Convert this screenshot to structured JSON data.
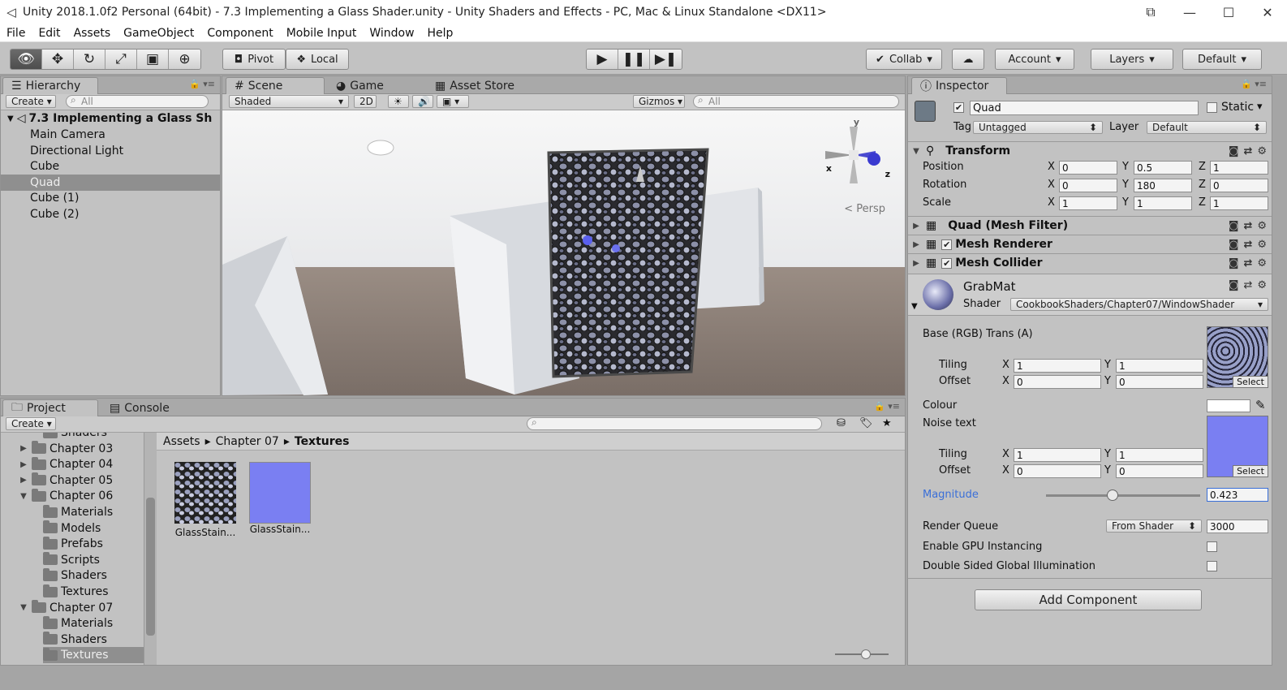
{
  "window": {
    "title": "Unity 2018.1.0f2 Personal (64bit) - 7.3 Implementing a Glass Shader.unity - Unity Shaders and Effects - PC, Mac & Linux Standalone <DX11>"
  },
  "menu": [
    "File",
    "Edit",
    "Assets",
    "GameObject",
    "Component",
    "Mobile Input",
    "Window",
    "Help"
  ],
  "toolbar": {
    "pivot": "Pivot",
    "local": "Local",
    "collab": "Collab",
    "account": "Account",
    "layers": "Layers",
    "layout": "Default"
  },
  "hierarchy": {
    "tab": "Hierarchy",
    "create": "Create",
    "search": "All",
    "scene": "7.3 Implementing a Glass Sh",
    "items": [
      "Main Camera",
      "Directional Light",
      "Cube",
      "Quad",
      "Cube (1)",
      "Cube (2)"
    ],
    "selected_index": 3
  },
  "scene": {
    "tabs": [
      "Scene",
      "Game",
      "Asset Store"
    ],
    "shading": "Shaded",
    "mode2d": "2D",
    "gizmos": "Gizmos",
    "search": "All",
    "persp": "< Persp",
    "axis_x": "x",
    "axis_z": "z",
    "axis_y": "y"
  },
  "project": {
    "tabs": [
      "Project",
      "Console"
    ],
    "create": "Create",
    "breadcrumb": [
      "Assets",
      "Chapter 07",
      "Textures"
    ],
    "tree": [
      {
        "label": "Shaders",
        "depth": 1,
        "arrow": ""
      },
      {
        "label": "Chapter 03",
        "depth": 0,
        "arrow": "▶"
      },
      {
        "label": "Chapter 04",
        "depth": 0,
        "arrow": "▶"
      },
      {
        "label": "Chapter 05",
        "depth": 0,
        "arrow": "▶"
      },
      {
        "label": "Chapter 06",
        "depth": 0,
        "arrow": "▼"
      },
      {
        "label": "Materials",
        "depth": 1,
        "arrow": ""
      },
      {
        "label": "Models",
        "depth": 1,
        "arrow": ""
      },
      {
        "label": "Prefabs",
        "depth": 1,
        "arrow": ""
      },
      {
        "label": "Scripts",
        "depth": 1,
        "arrow": ""
      },
      {
        "label": "Shaders",
        "depth": 1,
        "arrow": ""
      },
      {
        "label": "Textures",
        "depth": 1,
        "arrow": ""
      },
      {
        "label": "Chapter 07",
        "depth": 0,
        "arrow": "▼"
      },
      {
        "label": "Materials",
        "depth": 1,
        "arrow": ""
      },
      {
        "label": "Shaders",
        "depth": 1,
        "arrow": ""
      },
      {
        "label": "Textures",
        "depth": 1,
        "arrow": "",
        "selected": true
      }
    ],
    "assets": [
      {
        "label": "GlassStain..."
      },
      {
        "label": "GlassStain..."
      }
    ]
  },
  "inspector": {
    "tab": "Inspector",
    "name": "Quad",
    "static": "Static",
    "tag_label": "Tag",
    "tag": "Untagged",
    "layer_label": "Layer",
    "layer": "Default",
    "transform": {
      "title": "Transform",
      "position": {
        "label": "Position",
        "x": "0",
        "y": "0.5",
        "z": "1"
      },
      "rotation": {
        "label": "Rotation",
        "x": "0",
        "y": "180",
        "z": "0"
      },
      "scale": {
        "label": "Scale",
        "x": "1",
        "y": "1",
        "z": "1"
      }
    },
    "components": [
      "Quad (Mesh Filter)",
      "Mesh Renderer",
      "Mesh Collider"
    ],
    "material": {
      "name": "GrabMat",
      "shader_label": "Shader",
      "shader": "CookbookShaders/Chapter07/WindowShader",
      "base_label": "Base (RGB) Trans (A)",
      "tiling": "Tiling",
      "offset": "Offset",
      "base_tiling": {
        "x": "1",
        "y": "1"
      },
      "base_offset": {
        "x": "0",
        "y": "0"
      },
      "colour": "Colour",
      "noise": "Noise text",
      "noise_tiling": {
        "x": "1",
        "y": "1"
      },
      "noise_offset": {
        "x": "0",
        "y": "0"
      },
      "magnitude_label": "Magnitude",
      "magnitude": "0.423",
      "render_queue_label": "Render Queue",
      "render_queue_mode": "From Shader",
      "render_queue": "3000",
      "gpu_instancing": "Enable GPU Instancing",
      "double_sided": "Double Sided Global Illumination",
      "select": "Select"
    },
    "add_component": "Add Component"
  },
  "axis": {
    "x": "X",
    "y": "Y",
    "z": "Z"
  },
  "colors": {
    "accent": "#3a6fd8",
    "noise_tex": "#7a7ff2",
    "selected_row": "#8f8f8f"
  }
}
